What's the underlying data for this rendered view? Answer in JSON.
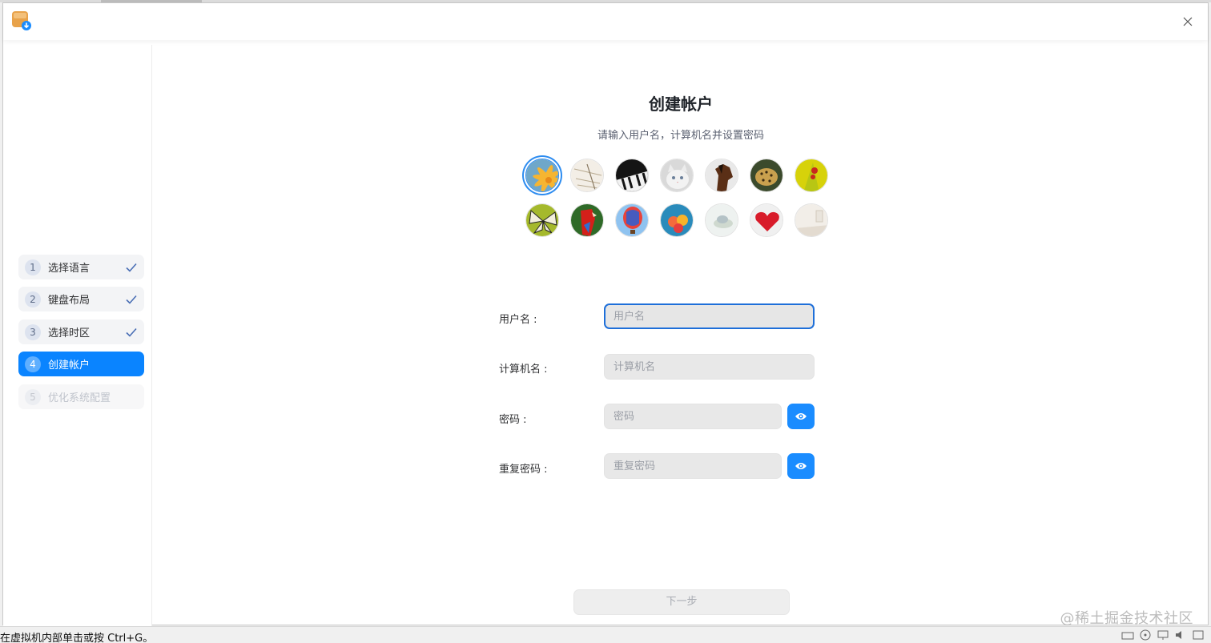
{
  "window": {
    "close_label": "×"
  },
  "sidebar": {
    "steps": [
      {
        "num": "1",
        "label": "选择语言",
        "state": "done"
      },
      {
        "num": "2",
        "label": "键盘布局",
        "state": "done"
      },
      {
        "num": "3",
        "label": "选择时区",
        "state": "done"
      },
      {
        "num": "4",
        "label": "创建帐户",
        "state": "active"
      },
      {
        "num": "5",
        "label": "优化系统配置",
        "state": "disabled"
      }
    ]
  },
  "main": {
    "title": "创建帐户",
    "subtitle": "请输入用户名，计算机名并设置密码",
    "avatars": [
      "flower",
      "papers",
      "piano",
      "kitten",
      "horse",
      "leopard",
      "ladybug",
      "butterfly",
      "parrot",
      "hot-air-balloon",
      "balloons",
      "shell",
      "heart",
      "room"
    ],
    "selected_avatar": "flower",
    "fields": {
      "username": {
        "label": "用户名 :",
        "placeholder": "用户名",
        "value": ""
      },
      "hostname": {
        "label": "计算机名 :",
        "placeholder": "计算机名",
        "value": ""
      },
      "password": {
        "label": "密码 :",
        "placeholder": "密码",
        "value": ""
      },
      "repeat_password": {
        "label": "重复密码 :",
        "placeholder": "重复密码",
        "value": ""
      }
    },
    "next_button": "下一步"
  },
  "statusbar": {
    "hint": "在虚拟机内部单击或按 Ctrl+G。"
  },
  "watermark": "@稀土掘金技术社区",
  "colors": {
    "accent": "#0a84ff",
    "eye_button": "#1a8cff",
    "focus_border": "#1e6fd9"
  }
}
